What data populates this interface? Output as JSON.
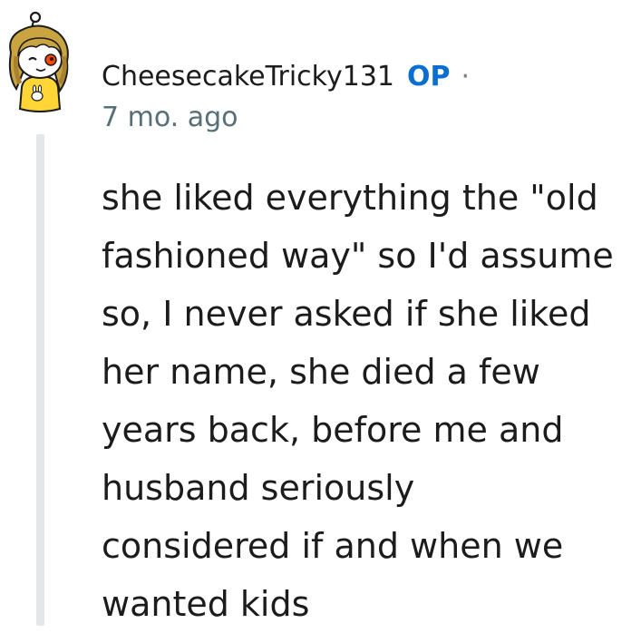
{
  "comment": {
    "username": "CheesecakeTricky131",
    "op_badge": "OP",
    "separator": "·",
    "timestamp": "7 mo. ago",
    "avatar_icon": "snoo-avatar-icon",
    "body_lines": [
      "she liked everything the \"old",
      "fashioned way\" so I'd assume",
      "so, I never asked if she liked",
      "her name, she died a few",
      "years back, before me and",
      "husband seriously",
      "considered if and when we",
      "wanted kids"
    ]
  },
  "colors": {
    "op_accent": "#0a6fd1",
    "text": "#1c1c1c",
    "meta_text": "#576f76",
    "thread_line": "#e4e7ea"
  }
}
